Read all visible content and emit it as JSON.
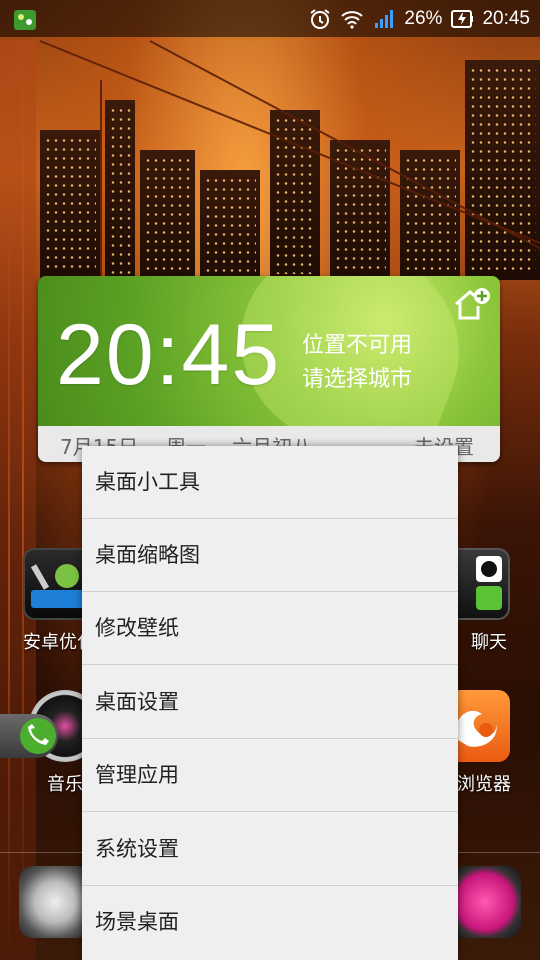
{
  "status_bar": {
    "battery_percent": "26%",
    "time": "20:45",
    "icons": [
      "app-notification-icon",
      "alarm-icon",
      "wifi-icon",
      "signal-icon",
      "battery-charging-icon"
    ]
  },
  "clock_widget": {
    "time": "20:45",
    "location_line1": "位置不可用",
    "location_line2": "请选择城市",
    "date": "7月15日",
    "weekday": "周一",
    "lunar": "六月初八",
    "settings_label": "未设置",
    "accent_color": "#6ab02e"
  },
  "apps": {
    "left_row1": "安卓优化",
    "right_row1": "聊天",
    "left_row2": "音乐",
    "right_row2": "浏览器"
  },
  "menu": {
    "items": [
      "桌面小工具",
      "桌面缩略图",
      "修改壁纸",
      "桌面设置",
      "管理应用",
      "系统设置",
      "场景桌面"
    ]
  }
}
